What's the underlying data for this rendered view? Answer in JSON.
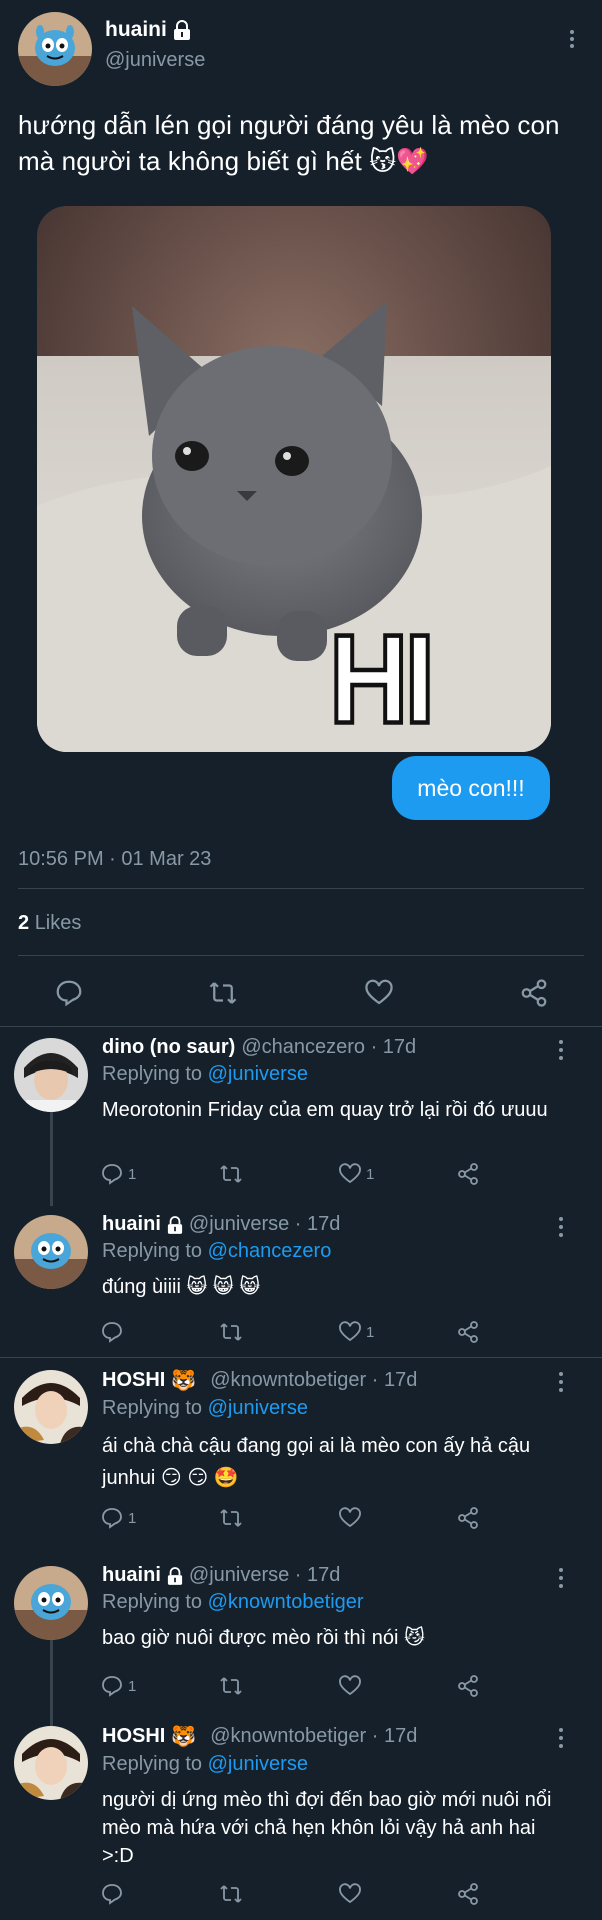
{
  "main_tweet": {
    "display_name": "huaini",
    "handle": "@juniverse",
    "text": "hướng dẫn lén gọi người đáng yêu là mèo con mà người ta không biết gì hết 😽💖",
    "image_overlay": "HI",
    "bubble": "mèo con!!!",
    "timestamp": "10:56 PM · 01 Mar 23",
    "likes_count": "2",
    "likes_label": "Likes"
  },
  "replies": [
    {
      "name": "dino (no saur)",
      "handle": "@chancezero · 17d",
      "replying_prefix": "Replying to",
      "replying_to": "@juniverse",
      "text": "Meorotonin Friday của em quay trở lại rồi đó ưuuu",
      "reply_count": "1",
      "like_count": "1",
      "locked": false,
      "badge": ""
    },
    {
      "name": "huaini",
      "handle": "@juniverse · 17d",
      "replying_prefix": "Replying to",
      "replying_to": "@chancezero",
      "text": "đúng ùiiii 😸 😸 😸",
      "reply_count": "",
      "like_count": "1",
      "locked": true,
      "badge": ""
    },
    {
      "name": "HOSHI",
      "handle": "@knowntobetiger · 17d",
      "replying_prefix": "Replying to",
      "replying_to": "@juniverse",
      "text": "ái chà chà cậu đang gọi ai là mèo con ấy hả cậu junhui 😏 😏 🤩",
      "reply_count": "1",
      "like_count": "",
      "locked": false,
      "badge": "🐯"
    },
    {
      "name": "huaini",
      "handle": "@juniverse · 17d",
      "replying_prefix": "Replying to",
      "replying_to": "@knowntobetiger",
      "text": "bao giờ nuôi được mèo rồi thì nói 😼",
      "reply_count": "1",
      "like_count": "",
      "locked": true,
      "badge": ""
    },
    {
      "name": "HOSHI",
      "handle": "@knowntobetiger · 17d",
      "replying_prefix": "Replying to",
      "replying_to": "@juniverse",
      "text": "người dị ứng mèo thì đợi đến bao giờ mới nuôi nổi mèo mà hứa với chả hẹn khôn lỏi vậy hả anh hai >:D",
      "reply_count": "",
      "like_count": "",
      "locked": false,
      "badge": "🐯"
    }
  ],
  "icons": {
    "reply": "reply-icon",
    "retweet": "retweet-icon",
    "like": "heart-icon",
    "share": "share-icon",
    "more": "more-icon",
    "lock": "lock-icon"
  },
  "colors": {
    "background": "#15202b",
    "accent": "#1d9bf0",
    "muted": "#8899a6",
    "divider": "#38444d"
  }
}
